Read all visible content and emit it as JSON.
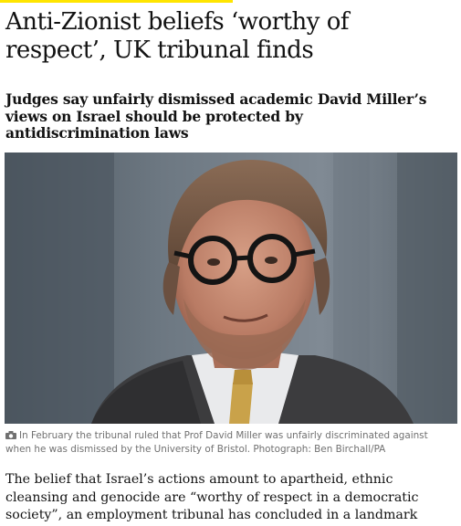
{
  "article": {
    "headline": "Anti-Zionist beliefs ‘worthy of respect’, UK tribunal finds",
    "standfirst": "Judges say unfairly dismissed academic David Miller’s views on Israel should be protected by antidiscrimination laws",
    "photo": {
      "icon": "camera-icon"
    },
    "caption": "In February the tribunal ruled that Prof David Miller was unfairly discriminated against when he was dismissed by the University of Bristol. Photograph: Ben Birchall/PA",
    "body_first_paragraph": "The belief that Israel’s actions amount to apartheid, ethnic cleansing and genocide are “worthy of respect in a democratic society”, an employment tribunal has concluded in a landmark decision."
  },
  "colors": {
    "accent": "#ffe500",
    "text": "#121212",
    "caption": "#707070"
  }
}
